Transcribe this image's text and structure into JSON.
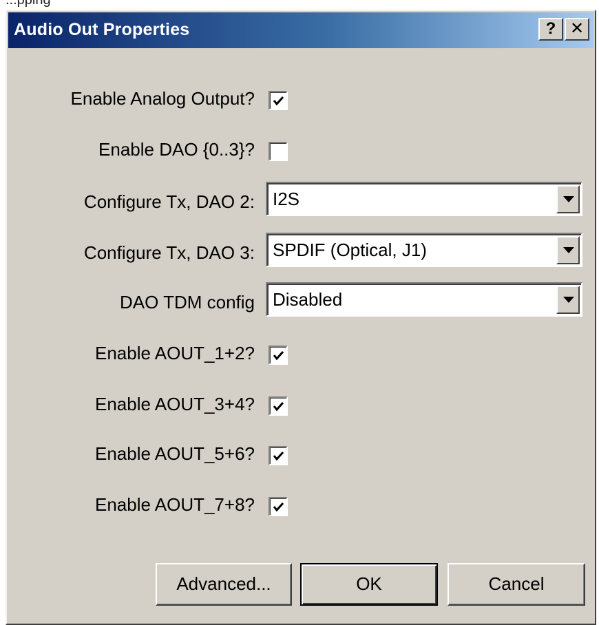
{
  "top_text": "...pping",
  "dialog": {
    "title": "Audio Out Properties",
    "help_button": "?",
    "close_button": "✕"
  },
  "fields": [
    {
      "label": "Enable Analog Output?",
      "type": "checkbox",
      "checked": true
    },
    {
      "label": "Enable DAO {0..3}?",
      "type": "checkbox",
      "checked": false
    },
    {
      "label": "Configure Tx, DAO 2:",
      "type": "combo",
      "value": "I2S"
    },
    {
      "label": "Configure Tx, DAO 3:",
      "type": "combo",
      "value": "SPDIF (Optical, J1)"
    },
    {
      "label": "DAO TDM config",
      "type": "combo",
      "value": "Disabled"
    },
    {
      "label": "Enable AOUT_1+2?",
      "type": "checkbox",
      "checked": true
    },
    {
      "label": "Enable AOUT_3+4?",
      "type": "checkbox",
      "checked": true
    },
    {
      "label": "Enable AOUT_5+6?",
      "type": "checkbox",
      "checked": true
    },
    {
      "label": "Enable AOUT_7+8?",
      "type": "checkbox",
      "checked": true
    }
  ],
  "buttons": {
    "advanced": "Advanced...",
    "ok": "OK",
    "cancel": "Cancel"
  },
  "icons": {
    "help": "question-mark-icon",
    "close": "close-icon",
    "check": "checkmark-icon",
    "dropdown": "triangle-down-icon"
  },
  "colors": {
    "titlebar_start": "#0a246a",
    "titlebar_end": "#a6caf0",
    "dialog_face": "#d4d0c8"
  }
}
